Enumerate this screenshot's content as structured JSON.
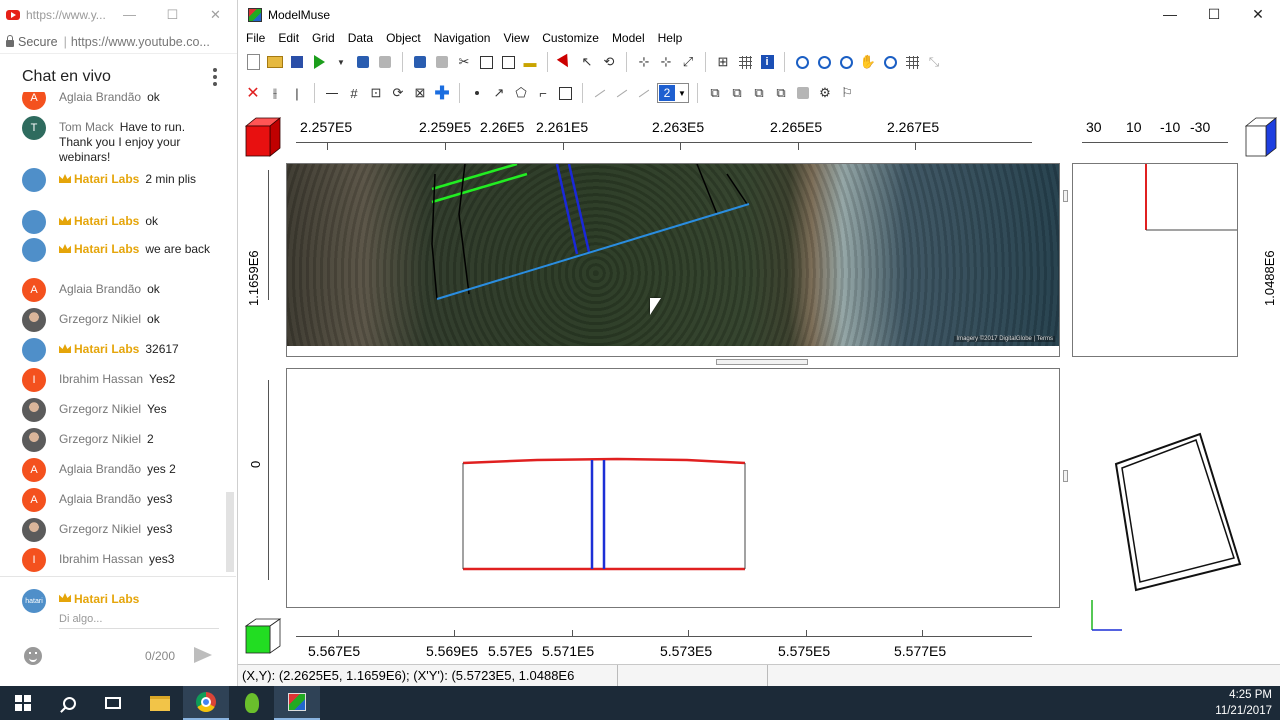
{
  "chat_window": {
    "tab_title": "https://www.y...",
    "address_secure": "Secure",
    "address_url": "https://www.youtube.co...",
    "header_title": "Chat en vivo",
    "messages": [
      {
        "author": "Aglaia Brandão",
        "text": "ok",
        "owner": false,
        "avatar_letter": "A",
        "avatar_color": "#f4511e"
      },
      {
        "author": "Tom Mack",
        "text": "Have to run. Thank you I enjoy your webinars!",
        "owner": false,
        "avatar_letter": "T",
        "avatar_color": "#2e6b5e"
      },
      {
        "author": "Hatari Labs",
        "text": "2 min plis",
        "owner": true,
        "avatar_letter": "",
        "avatar_color": "#4f8fc9"
      },
      {
        "author": "Hatari Labs",
        "text": "ok",
        "owner": true,
        "avatar_letter": "",
        "avatar_color": "#4f8fc9"
      },
      {
        "author": "Hatari Labs",
        "text": "we are back",
        "owner": true,
        "avatar_letter": "",
        "avatar_color": "#4f8fc9"
      },
      {
        "author": "Aglaia Brandão",
        "text": "ok",
        "owner": false,
        "avatar_letter": "A",
        "avatar_color": "#f4511e"
      },
      {
        "author": "Grzegorz Nikiel",
        "text": "ok",
        "owner": false,
        "avatar_letter": "",
        "avatar_color": "photo"
      },
      {
        "author": "Hatari Labs",
        "text": "32617",
        "owner": true,
        "avatar_letter": "",
        "avatar_color": "#4f8fc9"
      },
      {
        "author": "Ibrahim Hassan",
        "text": "Yes2",
        "owner": false,
        "avatar_letter": "I",
        "avatar_color": "#f4511e"
      },
      {
        "author": "Grzegorz Nikiel",
        "text": "Yes",
        "owner": false,
        "avatar_letter": "",
        "avatar_color": "photo"
      },
      {
        "author": "Grzegorz Nikiel",
        "text": "2",
        "owner": false,
        "avatar_letter": "",
        "avatar_color": "photo"
      },
      {
        "author": "Aglaia Brandão",
        "text": "yes 2",
        "owner": false,
        "avatar_letter": "A",
        "avatar_color": "#f4511e"
      },
      {
        "author": "Aglaia Brandão",
        "text": "yes3",
        "owner": false,
        "avatar_letter": "A",
        "avatar_color": "#f4511e"
      },
      {
        "author": "Grzegorz Nikiel",
        "text": "yes3",
        "owner": false,
        "avatar_letter": "",
        "avatar_color": "photo"
      },
      {
        "author": "Ibrahim Hassan",
        "text": "yes3",
        "owner": false,
        "avatar_letter": "I",
        "avatar_color": "#f4511e"
      }
    ],
    "current_user": "Hatari Labs",
    "input_placeholder": "Di algo...",
    "char_count": "0/200"
  },
  "modelmuse": {
    "title": "ModelMuse",
    "menu": [
      "File",
      "Edit",
      "Grid",
      "Data",
      "Object",
      "Navigation",
      "View",
      "Customize",
      "Model",
      "Help"
    ],
    "layer_value": "2",
    "top_ruler_labels": [
      "2.257E5",
      "2.259E5",
      "2.26E5",
      "2.261E5",
      "2.263E5",
      "2.265E5",
      "2.267E5"
    ],
    "side_ruler_labels": [
      "30",
      "10",
      "-10",
      "-30"
    ],
    "top_view_y_label": "1.1659E6",
    "side_view_y_label": "1.0488E6",
    "front_view_y_label": "0",
    "bottom_ruler_labels": [
      "5.567E5",
      "5.569E5",
      "5.57E5",
      "5.571E5",
      "5.573E5",
      "5.575E5",
      "5.577E5"
    ],
    "imagery_credit": "Imagery ©2017 DigitalGlobe | Terms",
    "status_text": "(X,Y): (2.2625E5, 1.1659E6); (X'Y'): (5.5723E5, 1.0488E6"
  },
  "taskbar": {
    "time": "4:25 PM",
    "date": "11/21/2017"
  },
  "colors": {
    "owner_name": "#e5a50a",
    "model_red": "#e02020",
    "model_blue": "#1c2fd6",
    "taskbar": "#1c2a38"
  }
}
